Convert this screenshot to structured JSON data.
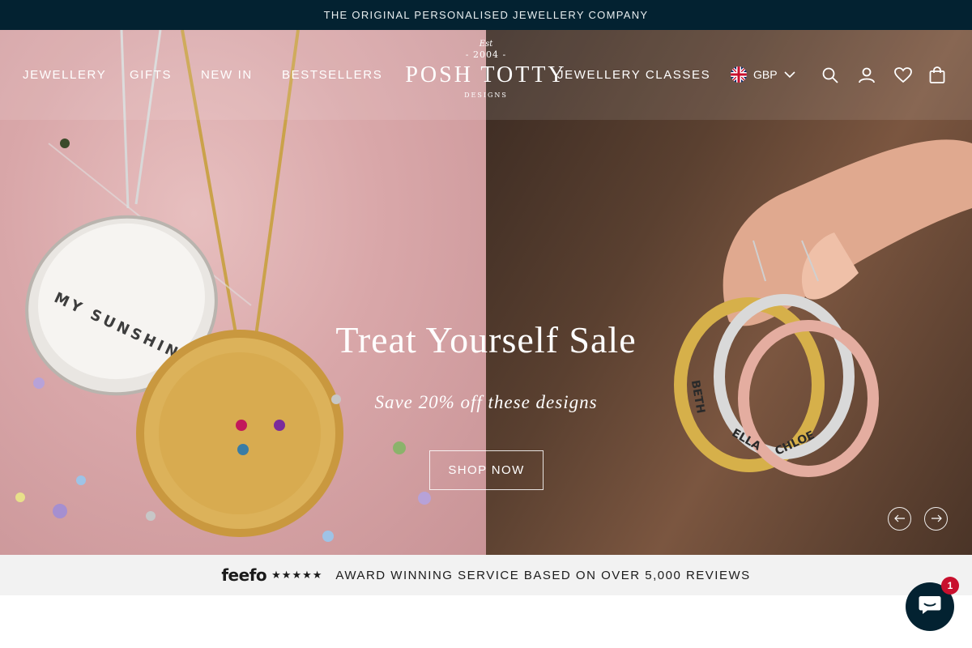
{
  "announcement": {
    "text": "THE ORIGINAL PERSONALISED JEWELLERY COMPANY"
  },
  "nav": {
    "items": [
      {
        "label": "JEWELLERY"
      },
      {
        "label": "GIFTS"
      },
      {
        "label": "NEW IN"
      },
      {
        "label": "BESTSELLERS"
      },
      {
        "label": "JEWELLERY CLASSES"
      }
    ]
  },
  "logo": {
    "est": "Est",
    "year": "- 2004 -",
    "name": "POSH TOTTY",
    "sub": "DESIGNS"
  },
  "currency": {
    "code": "GBP",
    "flag_icon": "uk-flag-icon"
  },
  "header_icons": [
    "search-icon",
    "account-icon",
    "wishlist-heart-icon",
    "cart-bag-icon"
  ],
  "hero": {
    "title": "Treat Yourself Sale",
    "subtitle": "Save 20% off these designs",
    "cta_label": "SHOP NOW",
    "left_pendant_engraving": "MY SUNSHINE",
    "right_ring_names": [
      "BETH",
      "ELLA",
      "CHLOE"
    ],
    "prev_icon": "arrow-left-icon",
    "next_icon": "arrow-right-icon"
  },
  "reviews_bar": {
    "brand": "feefo",
    "stars_glyph": "★★★★★",
    "rating_stars": 5,
    "text": "AWARD WINNING SERVICE BASED ON OVER 5,000 REVIEWS"
  },
  "chat": {
    "badge_count": "1"
  },
  "colors": {
    "announcement_bg": "#032231",
    "reviews_bg": "#f2f2f2",
    "chat_bg": "#032231",
    "badge": "#c8102e"
  }
}
